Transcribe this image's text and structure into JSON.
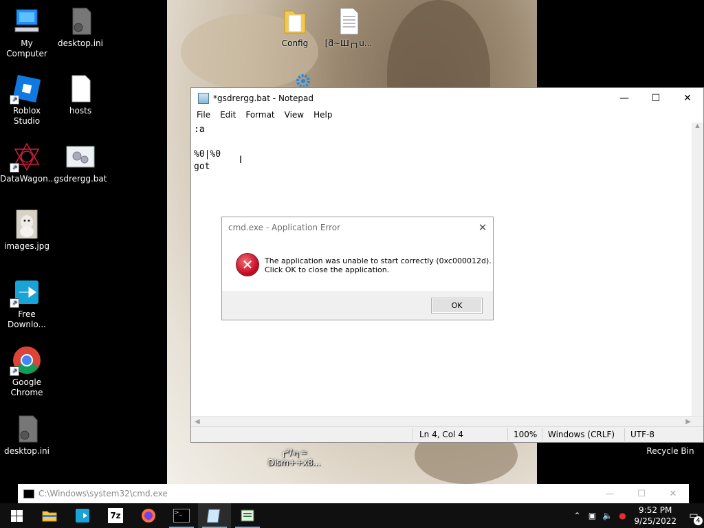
{
  "desktop": {
    "icons": [
      {
        "label": "My Computer",
        "icon": "computer-icon"
      },
      {
        "label": "desktop.ini",
        "icon": "settings-file-icon"
      },
      {
        "label": "Roblox Studio",
        "icon": "roblox-studio-icon"
      },
      {
        "label": "hosts",
        "icon": "file-icon"
      },
      {
        "label": "DataWagon...",
        "icon": "datawagon-icon"
      },
      {
        "label": "gsdrergg.bat",
        "icon": "batch-file-icon"
      },
      {
        "label": "images.jpg",
        "icon": "image-file-icon"
      },
      {
        "label": "Free Downlo...",
        "icon": "download-manager-icon"
      },
      {
        "label": "Google Chrome",
        "icon": "chrome-icon"
      },
      {
        "label": "desktop.ini",
        "icon": "settings-file-icon"
      },
      {
        "label": "Config",
        "icon": "folder-icon"
      },
      {
        "label": "[ƌ~Ш┌┐u...",
        "icon": "text-file-icon"
      },
      {
        "label": "Recycle Bin",
        "icon": "recycle-bin-icon"
      },
      {
        "label": "┌²/₄┐≈",
        "icon": "text-file-icon"
      },
      {
        "label": "Dism++x8...",
        "icon": "app-icon"
      }
    ]
  },
  "notepad": {
    "title": "*gsdrergg.bat - Notepad",
    "menu": [
      "File",
      "Edit",
      "Format",
      "View",
      "Help"
    ],
    "content": ":a\n\n%0|%0\ngot",
    "status": {
      "position": "Ln 4, Col 4",
      "zoom": "100%",
      "line_ending": "Windows (CRLF)",
      "encoding": "UTF-8"
    }
  },
  "error_dialog": {
    "title": "cmd.exe - Application Error",
    "message_line1": "The application was unable to start correctly (0xc000012d).",
    "message_line2": "Click OK to close the application.",
    "ok_label": "OK"
  },
  "cmd_window": {
    "title": "C:\\Windows\\system32\\cmd.exe"
  },
  "taskbar": {
    "apps": [
      "file-explorer-icon",
      "download-manager-icon",
      "7zip-icon",
      "firefox-icon",
      "cmd-icon",
      "notepad-icon",
      "notepad-alt-icon"
    ],
    "seven_zip_label": "7z",
    "clock_time": "9:52 PM",
    "clock_date": "9/25/2022",
    "notification_count": "4"
  },
  "colors": {
    "desktop_bg": "#000000",
    "taskbar_bg": "#101010",
    "error_red": "#c8102e",
    "accent": "#0078d7"
  }
}
